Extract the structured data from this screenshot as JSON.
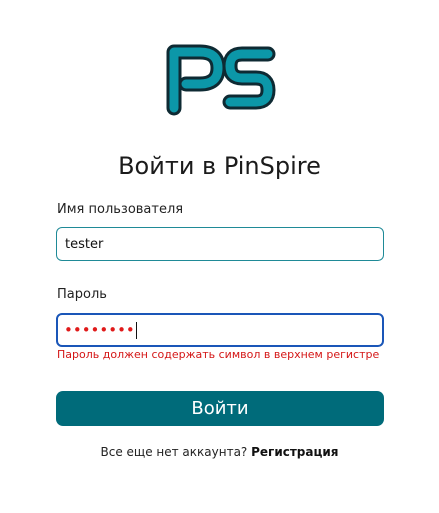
{
  "brand": {
    "logo_letters": "PS",
    "logo_color": "#0c97a8",
    "logo_outline": "#0e2a33"
  },
  "login": {
    "title": "Войти в PinSpire",
    "username_label": "Имя пользователя",
    "username_value": "tester",
    "password_label": "Пароль",
    "password_mask": "••••••••",
    "password_error": "Пароль должен содержать символ в верхнем регистре",
    "submit_label": "Войти",
    "signup_prompt": "Все еще нет аккаунта?",
    "signup_link": "Регистрация"
  },
  "colors": {
    "accent": "#006b7a",
    "error": "#d41616",
    "focus_border": "#1a56b8"
  }
}
